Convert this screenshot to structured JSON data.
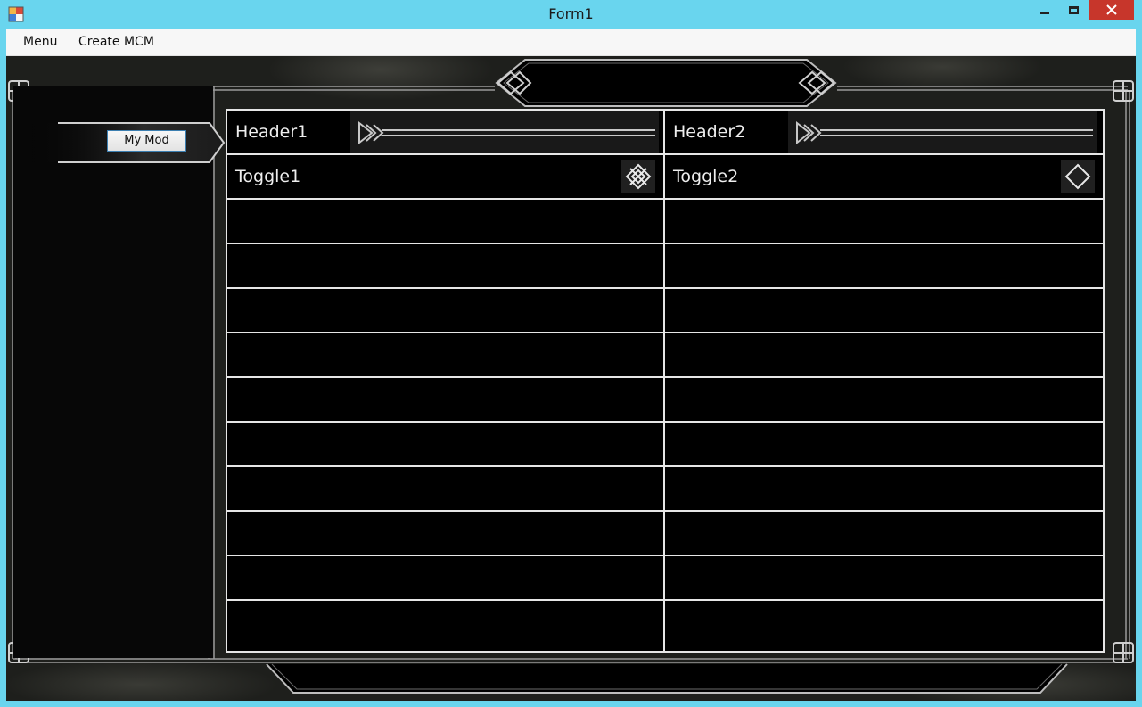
{
  "window": {
    "title": "Form1",
    "icon": "app-form-icon",
    "controls": [
      "minimize-icon",
      "maximize-icon",
      "close-icon"
    ],
    "accent_color": "#69d5ee",
    "close_color": "#c7362b"
  },
  "menubar": {
    "items": [
      {
        "label": "Menu"
      },
      {
        "label": "Create MCM"
      }
    ]
  },
  "sidebar": {
    "mod_button_label": "My Mod"
  },
  "grid": {
    "rows": [
      {
        "left": {
          "type": "header",
          "label": "Header1"
        },
        "right": {
          "type": "header",
          "label": "Header2"
        }
      },
      {
        "left": {
          "type": "toggle",
          "label": "Toggle1",
          "checked": true,
          "icon": "toggle-checked-icon"
        },
        "right": {
          "type": "toggle",
          "label": "Toggle2",
          "checked": false,
          "icon": "toggle-unchecked-icon"
        }
      },
      {
        "left": {
          "type": "empty",
          "label": ""
        },
        "right": {
          "type": "empty",
          "label": ""
        }
      },
      {
        "left": {
          "type": "empty",
          "label": ""
        },
        "right": {
          "type": "empty",
          "label": ""
        }
      },
      {
        "left": {
          "type": "empty",
          "label": ""
        },
        "right": {
          "type": "empty",
          "label": ""
        }
      },
      {
        "left": {
          "type": "empty",
          "label": ""
        },
        "right": {
          "type": "empty",
          "label": ""
        }
      },
      {
        "left": {
          "type": "empty",
          "label": ""
        },
        "right": {
          "type": "empty",
          "label": ""
        }
      },
      {
        "left": {
          "type": "empty",
          "label": ""
        },
        "right": {
          "type": "empty",
          "label": ""
        }
      },
      {
        "left": {
          "type": "empty",
          "label": ""
        },
        "right": {
          "type": "empty",
          "label": ""
        }
      },
      {
        "left": {
          "type": "empty",
          "label": ""
        },
        "right": {
          "type": "empty",
          "label": ""
        }
      },
      {
        "left": {
          "type": "empty",
          "label": ""
        },
        "right": {
          "type": "empty",
          "label": ""
        }
      },
      {
        "left": {
          "type": "empty",
          "label": ""
        },
        "right": {
          "type": "empty",
          "label": ""
        }
      }
    ]
  }
}
